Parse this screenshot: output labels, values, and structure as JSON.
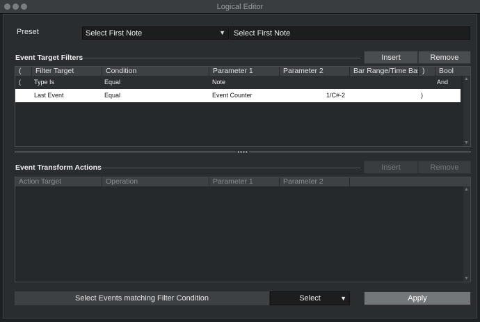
{
  "window": {
    "title": "Logical Editor"
  },
  "preset": {
    "label": "Preset",
    "selected": "Select First Note",
    "name_value": "Select First Note"
  },
  "filters": {
    "title": "Event Target Filters",
    "insert_label": "Insert",
    "remove_label": "Remove",
    "columns": [
      "(",
      "Filter Target",
      "Condition",
      "Parameter 1",
      "Parameter 2",
      "Bar Range/Time Base",
      ")",
      "Bool"
    ],
    "rows": [
      {
        "open": "(",
        "target": "Type Is",
        "condition": "Equal",
        "param1": "Note",
        "param2": "",
        "range": "",
        "close": "",
        "bool": "And"
      },
      {
        "open": "",
        "target": "Last Event",
        "condition": "Equal",
        "param1": "Event Counter",
        "param2": "1/C#-2",
        "range": "",
        "close": ")",
        "bool": ""
      }
    ]
  },
  "actions": {
    "title": "Event Transform Actions",
    "insert_label": "Insert",
    "remove_label": "Remove",
    "columns": [
      "Action Target",
      "Operation",
      "Parameter 1",
      "Parameter 2"
    ]
  },
  "bottom": {
    "function_label": "Select Events matching Filter Condition",
    "mode_selected": "Select",
    "apply_label": "Apply"
  }
}
